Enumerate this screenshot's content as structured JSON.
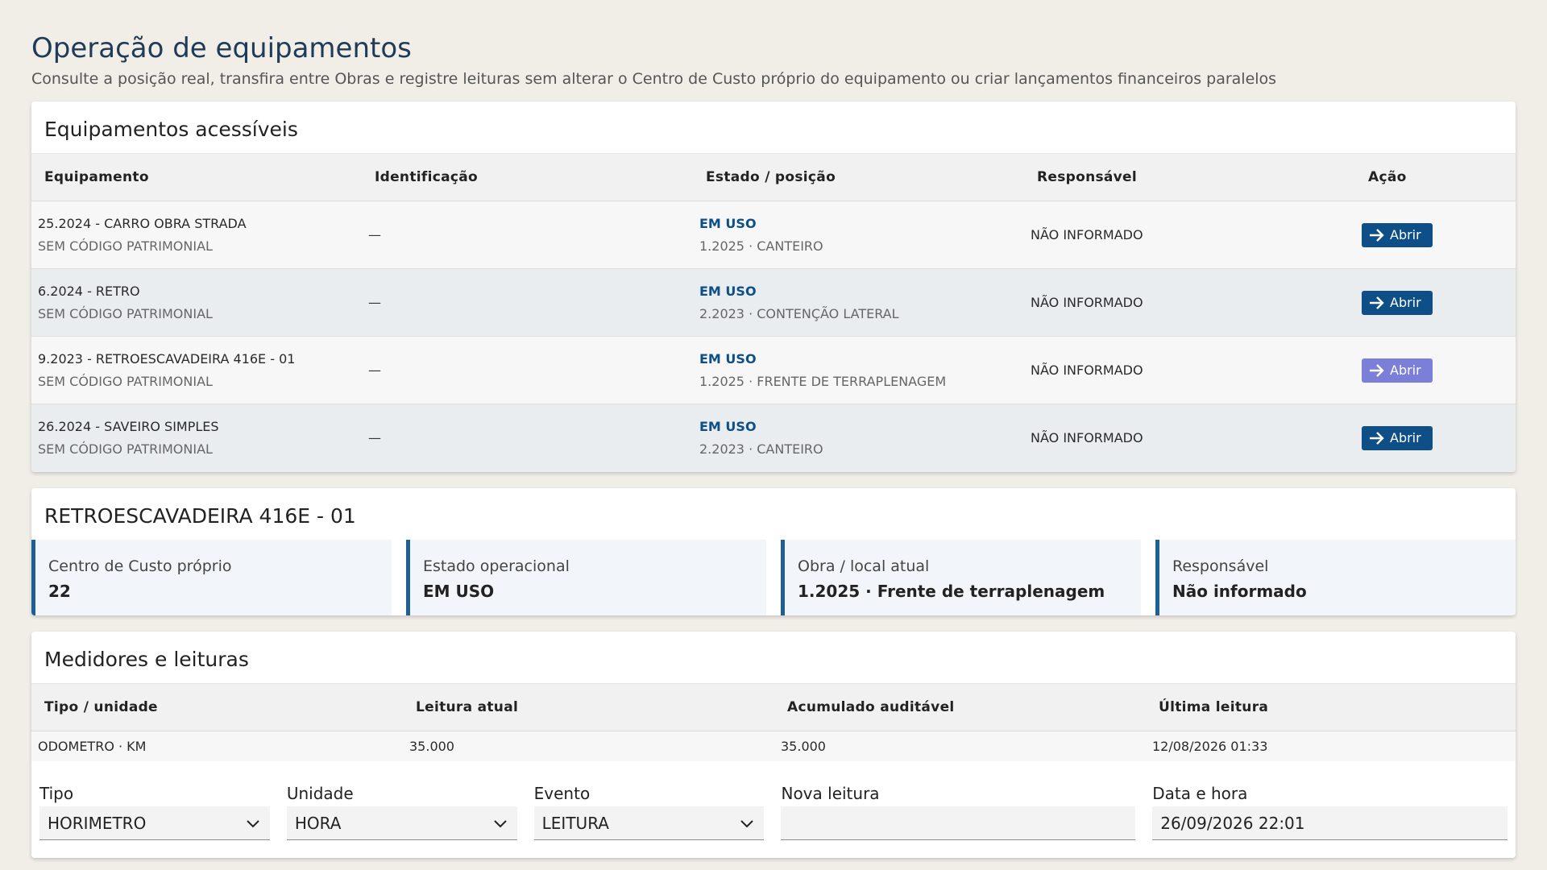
{
  "page": {
    "title": "Operação de equipamentos",
    "subtitle": "Consulte a posição real, transfira entre Obras e registre leituras sem alterar o Centro de Custo próprio do equipamento ou criar lançamentos financeiros paralelos"
  },
  "equipment_card": {
    "title": "Equipamentos acessíveis",
    "columns": [
      "Equipamento",
      "Identificação",
      "Estado / posição",
      "Responsável",
      "Ação"
    ],
    "rows": [
      {
        "name": "25.2024 - CARRO OBRA STRADA",
        "code": "SEM CÓDIGO PATRIMONIAL",
        "id": "—",
        "state": "EM USO",
        "position": "1.2025 · CANTEIRO",
        "responsible": "NÃO INFORMADO",
        "action": "Abrir"
      },
      {
        "name": "6.2024 - RETRO",
        "code": "SEM CÓDIGO PATRIMONIAL",
        "id": "—",
        "state": "EM USO",
        "position": "2.2023 · CONTENÇÃO LATERAL",
        "responsible": "NÃO INFORMADO",
        "action": "Abrir"
      },
      {
        "name": "9.2023 - RETROESCAVADEIRA 416E - 01",
        "code": "SEM CÓDIGO PATRIMONIAL",
        "id": "—",
        "state": "EM USO",
        "position": "1.2025 · FRENTE DE TERRAPLENAGEM",
        "responsible": "NÃO INFORMADO",
        "action": "Abrir"
      },
      {
        "name": "26.2024 - SAVEIRO SIMPLES",
        "code": "SEM CÓDIGO PATRIMONIAL",
        "id": "—",
        "state": "EM USO",
        "position": "2.2023 · CANTEIRO",
        "responsible": "NÃO INFORMADO",
        "action": "Abrir"
      }
    ]
  },
  "detail_card": {
    "title": "RETROESCAVADEIRA 416E - 01",
    "kpis": [
      {
        "label": "Centro de Custo próprio",
        "value": "22"
      },
      {
        "label": "Estado operacional",
        "value": "EM USO"
      },
      {
        "label": "Obra / local atual",
        "value": "1.2025 · Frente de terraplenagem"
      },
      {
        "label": "Responsável",
        "value": "Não informado"
      }
    ]
  },
  "readings_card": {
    "title": "Medidores e leituras",
    "columns": [
      "Tipo / unidade",
      "Leitura atual",
      "Acumulado auditável",
      "Última leitura"
    ],
    "rows": [
      {
        "type": "ODOMETRO · KM",
        "current": "35.000",
        "accumulated": "35.000",
        "last": "12/08/2026 01:33"
      }
    ],
    "form": {
      "type_label": "Tipo",
      "type_value": "HORIMETRO",
      "unit_label": "Unidade",
      "unit_value": "HORA",
      "event_label": "Evento",
      "event_value": "LEITURA",
      "new_reading_label": "Nova leitura",
      "new_reading_value": "",
      "datetime_label": "Data e hora",
      "datetime_value": "26/09/2026 22:01"
    }
  },
  "colors": {
    "accent": "#0d4f86",
    "button_hover": "#7b7fd8",
    "background": "#f1eee8"
  },
  "icons": {
    "open_button": "arrow-right-icon",
    "select": "chevron-down-icon"
  }
}
